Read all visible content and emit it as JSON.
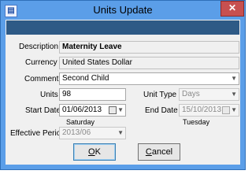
{
  "window": {
    "title": "Units Update",
    "icon": "form-icon",
    "close_label": "✕"
  },
  "form": {
    "description": {
      "label": "Description",
      "value": "Maternity Leave"
    },
    "currency": {
      "label": "Currency",
      "value": "United States Dollar"
    },
    "comment": {
      "label": "Comment",
      "value": "Second Child"
    },
    "units": {
      "label": "Units",
      "value": "98"
    },
    "unit_type": {
      "label": "Unit Type",
      "value": "Days"
    },
    "start_date": {
      "label": "Start Date",
      "value": "01/06/2013",
      "weekday": "Saturday"
    },
    "end_date": {
      "label": "End Date",
      "value": "15/10/2013",
      "weekday": "Tuesday"
    },
    "effective_period": {
      "label": "Effective Period",
      "value": "2013/06"
    }
  },
  "buttons": {
    "ok": {
      "mnemonic": "O",
      "rest": "K"
    },
    "cancel": {
      "mnemonic": "C",
      "rest": "ancel"
    }
  },
  "colors": {
    "frame": "#5b9ee8",
    "header_bar": "#2e5a86",
    "close": "#c75050"
  }
}
